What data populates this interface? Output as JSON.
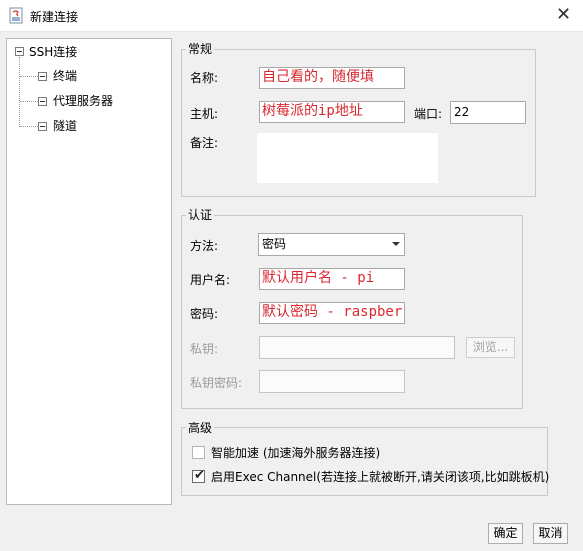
{
  "window": {
    "title": "新建连接",
    "close_glyph": "✕"
  },
  "tree": {
    "root": "SSH连接",
    "children": [
      "终端",
      "代理服务器",
      "隧道"
    ]
  },
  "general": {
    "legend": "常规",
    "name_label": "名称:",
    "name_value": "自己看的，随便填",
    "host_label": "主机:",
    "host_value": "树莓派的ip地址",
    "port_label": "端口:",
    "port_value": "22",
    "note_label": "备注:"
  },
  "auth": {
    "legend": "认证",
    "method_label": "方法:",
    "method_value": "密码",
    "user_label": "用户名:",
    "user_value": "默认用户名 - pi",
    "password_label": "密码:",
    "password_value": "默认密码 - raspberry",
    "private_key_label": "私钥:",
    "browse_label": "浏览...",
    "key_password_label": "私钥密码:"
  },
  "advanced": {
    "legend": "高级",
    "smart_accel_label": "智能加速 (加速海外服务器连接)",
    "smart_accel_checked": false,
    "exec_channel_label": "启用Exec Channel(若连接上就被断开,请关闭该项,比如跳板机)",
    "exec_channel_checked": true
  },
  "buttons": {
    "ok": "确定",
    "cancel": "取消"
  },
  "colors": {
    "annotation": "#d9282f"
  }
}
